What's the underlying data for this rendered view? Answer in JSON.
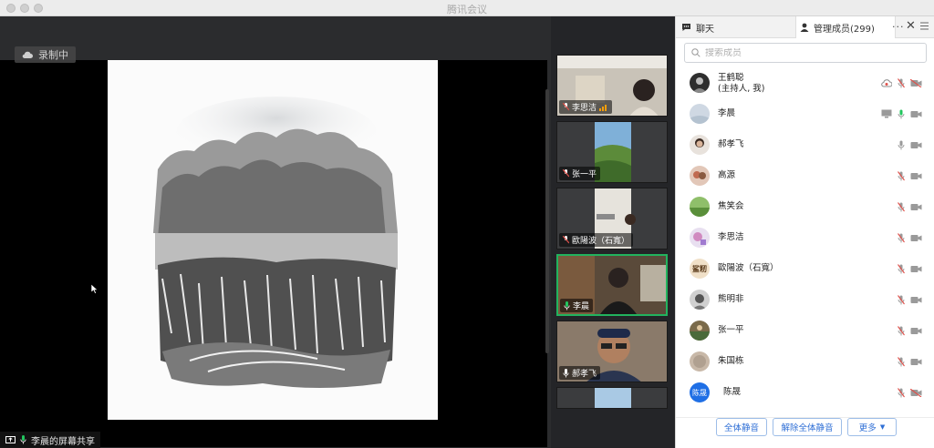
{
  "window": {
    "title": "腾讯会议"
  },
  "stage": {
    "recording_label": "录制中"
  },
  "share_label": "李晨的屏幕共享",
  "gallery": [
    {
      "name": "李思洁",
      "mic": "muted",
      "extra": "signal"
    },
    {
      "name": "张一平",
      "mic": "muted"
    },
    {
      "name": "歐陽波（石寬）",
      "mic": "muted"
    },
    {
      "name": "李晨",
      "mic": "on",
      "active": true
    },
    {
      "name": "郝孝飞",
      "mic": "on"
    }
  ],
  "panel": {
    "tab_chat": "聊天",
    "tab_members": "管理成员(299)",
    "search_placeholder": "搜索成员"
  },
  "members": [
    {
      "name": "王鹤聪",
      "sub": "(主持人, 我)",
      "icons": [
        "cloud-icon",
        "mic-muted-icon",
        "video-off-icon"
      ]
    },
    {
      "name": "李晨",
      "icons": [
        "screen-share-icon",
        "mic-active-icon",
        "video-icon"
      ]
    },
    {
      "name": "郝孝飞",
      "icons": [
        "mic-icon",
        "video-icon"
      ]
    },
    {
      "name": "高源",
      "icons": [
        "mic-muted-icon",
        "video-icon"
      ]
    },
    {
      "name": "焦笑会",
      "icons": [
        "mic-muted-icon",
        "video-icon"
      ]
    },
    {
      "name": "李思洁",
      "icons": [
        "mic-muted-icon",
        "video-icon"
      ]
    },
    {
      "name": "歐陽波（石寬）",
      "avatar_text": "鲨籾",
      "icons": [
        "mic-muted-icon",
        "video-icon"
      ]
    },
    {
      "name": "熊明非",
      "icons": [
        "mic-muted-icon",
        "video-icon"
      ]
    },
    {
      "name": "张一平",
      "icons": [
        "mic-muted-icon",
        "video-icon"
      ]
    },
    {
      "name": "朱国栋",
      "icons": [
        "mic-muted-icon",
        "video-icon"
      ]
    },
    {
      "name": "陈晟",
      "avatar_text": "陈晟",
      "icons": [
        "mic-muted-icon",
        "video-off-icon"
      ]
    }
  ],
  "footer": {
    "mute_all": "全体静音",
    "unmute_all": "解除全体静音",
    "more": "更多"
  },
  "colors": {
    "accent": "#2f6fd6",
    "active_border": "#22b35e",
    "muted_red": "#e0504a"
  }
}
